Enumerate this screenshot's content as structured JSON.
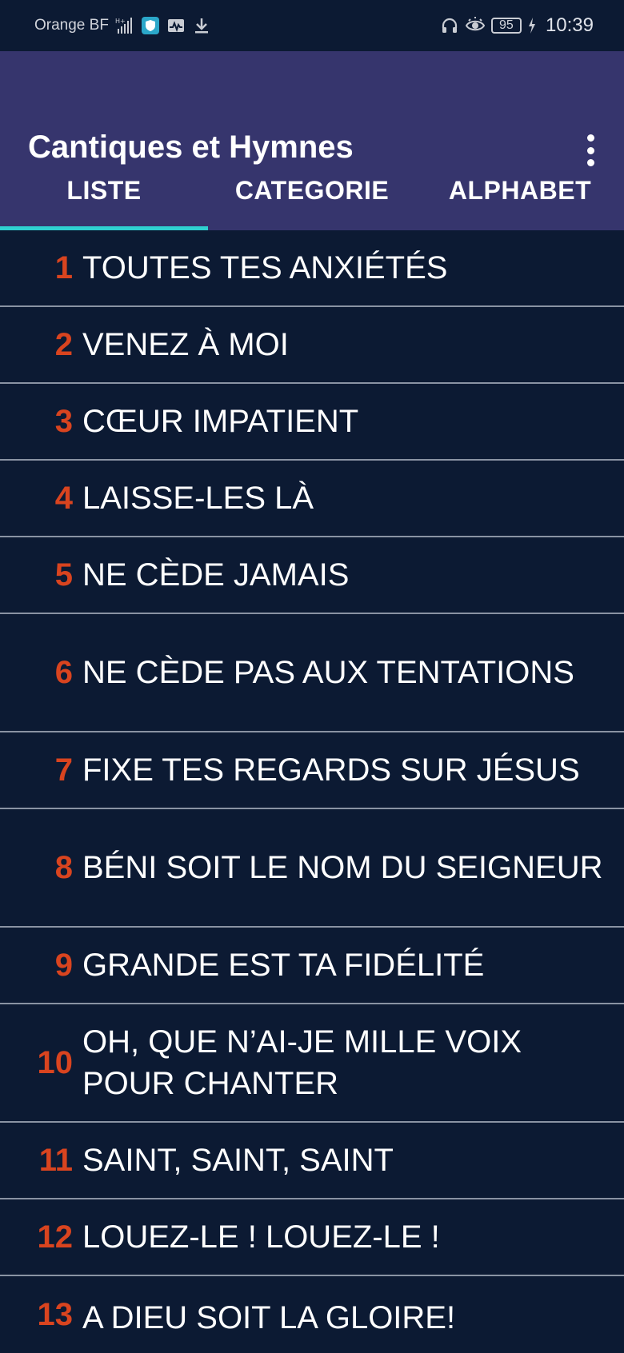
{
  "status": {
    "carrier": "Orange BF",
    "battery": "95",
    "time": "10:39"
  },
  "app": {
    "title": "Cantiques et Hymnes"
  },
  "tabs": [
    {
      "label": "LISTE",
      "active": true
    },
    {
      "label": "CATEGORIE",
      "active": false
    },
    {
      "label": "ALPHABET",
      "active": false
    }
  ],
  "hymns": [
    {
      "number": "1",
      "title": "TOUTES TES ANXIÉTÉS"
    },
    {
      "number": "2",
      "title": "VENEZ À MOI"
    },
    {
      "number": "3",
      "title": "CŒUR IMPATIENT"
    },
    {
      "number": "4",
      "title": "LAISSE-LES LÀ"
    },
    {
      "number": "5",
      "title": "NE CÈDE JAMAIS"
    },
    {
      "number": "6",
      "title": "NE CÈDE PAS AUX TENTATIONS"
    },
    {
      "number": "7",
      "title": "FIXE TES REGARDS SUR JÉSUS"
    },
    {
      "number": "8",
      "title": "BÉNI SOIT LE NOM DU SEIGNEUR"
    },
    {
      "number": "9",
      "title": "GRANDE EST TA FIDÉLITÉ"
    },
    {
      "number": "10",
      "title": "OH, QUE N’AI-JE MILLE VOIX POUR CHANTER"
    },
    {
      "number": "11",
      "title": "SAINT, SAINT, SAINT"
    },
    {
      "number": "12",
      "title": "LOUEZ-LE ! LOUEZ-LE !"
    },
    {
      "number": "13",
      "title": "A DIEU SOIT LA GLOIRE!"
    }
  ],
  "colors": {
    "background": "#0c1a33",
    "appbar": "#36356d",
    "number": "#d9441f",
    "tab_indicator": "#2fd0d0"
  }
}
